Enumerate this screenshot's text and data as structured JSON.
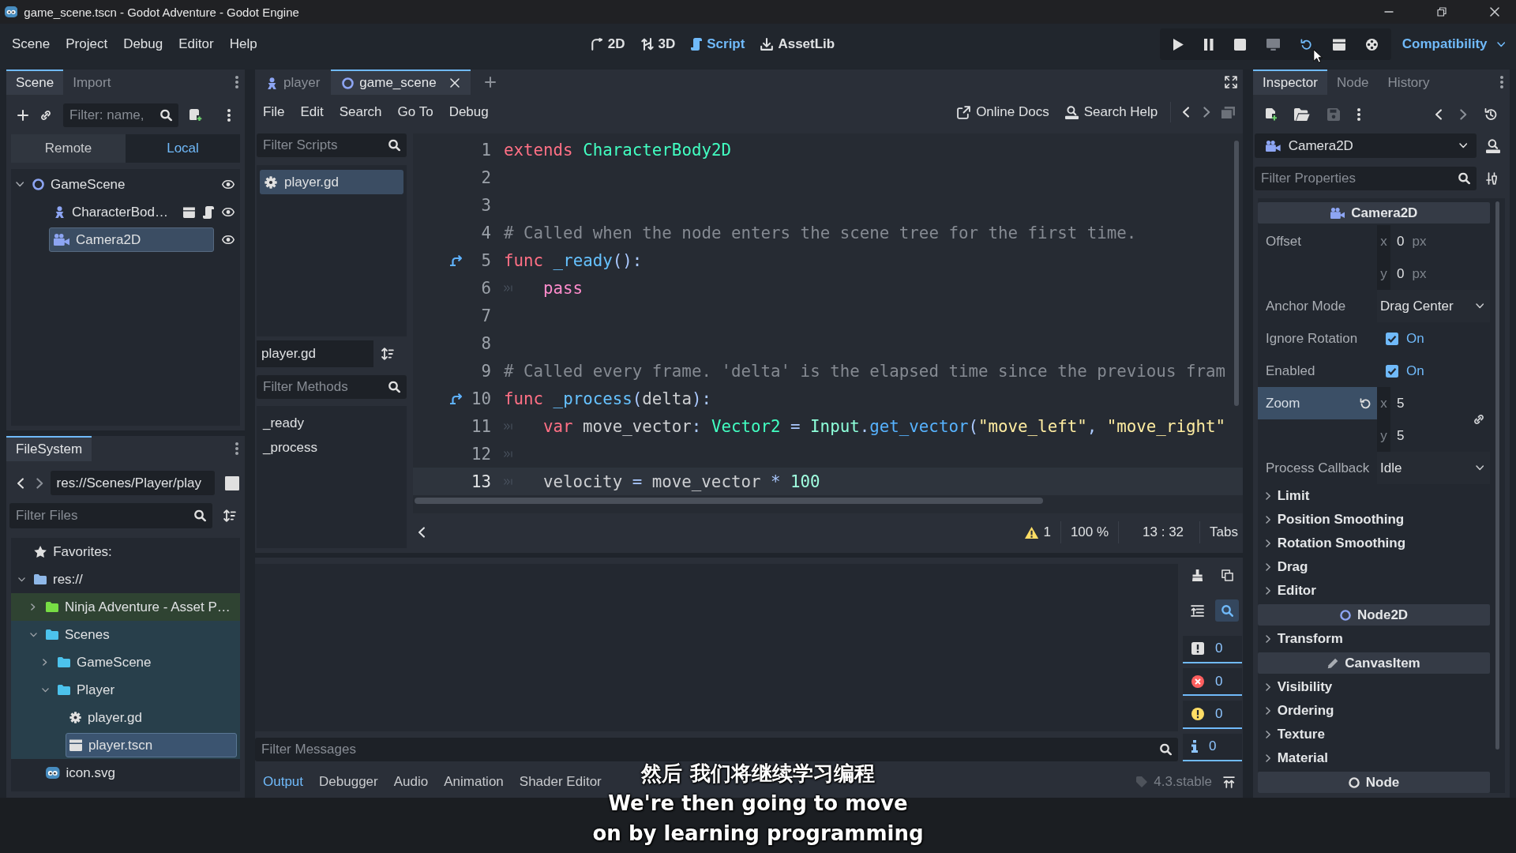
{
  "window": {
    "title": "game_scene.tscn - Godot Adventure - Godot Engine"
  },
  "menu": [
    "Scene",
    "Project",
    "Debug",
    "Editor",
    "Help"
  ],
  "workspaces": [
    {
      "label": "2D",
      "kind": "canvas",
      "selected": false
    },
    {
      "label": "3D",
      "kind": "spatial",
      "selected": false
    },
    {
      "label": "Script",
      "kind": "script",
      "selected": true
    },
    {
      "label": "AssetLib",
      "kind": "assetlib",
      "selected": false
    }
  ],
  "run_bar": {
    "buttons": [
      {
        "kind": "play",
        "hovered": false,
        "disabled": false
      },
      {
        "kind": "pause",
        "hovered": false,
        "disabled": false
      },
      {
        "kind": "stop",
        "hovered": false,
        "disabled": false
      },
      {
        "kind": "remote",
        "hovered": false,
        "disabled": true
      },
      {
        "kind": "reload",
        "hovered": true,
        "disabled": false
      },
      {
        "kind": "scene",
        "hovered": false,
        "disabled": false
      },
      {
        "kind": "movie",
        "hovered": false,
        "disabled": false
      }
    ],
    "renderer": "Compatibility"
  },
  "scene_dock": {
    "tabs": [
      {
        "label": "Scene",
        "selected": true
      },
      {
        "label": "Import",
        "selected": false
      }
    ],
    "filter": {
      "placeholder": "Filter: name,"
    },
    "modes": [
      {
        "label": "Remote",
        "selected": false
      },
      {
        "label": "Local",
        "selected": true
      }
    ],
    "tree": [
      {
        "label": "GameScene",
        "kind": "node2d",
        "expanded": true,
        "selected": false,
        "visible": true,
        "instance": false,
        "script": false,
        "children": [
          {
            "label": "CharacterBod…",
            "kind": "character",
            "selected": false,
            "visible": true,
            "instance": true,
            "script": true
          },
          {
            "label": "Camera2D",
            "kind": "camera",
            "selected": true,
            "visible": true,
            "instance": false,
            "script": false
          }
        ]
      }
    ]
  },
  "filesystem": {
    "tab": "FileSystem",
    "path": "res://Scenes/Player/play",
    "filter": {
      "placeholder": "Filter Files"
    },
    "tree": [
      {
        "label": "Favorites:",
        "kind": "favorites",
        "selected": false
      },
      {
        "label": "res://",
        "kind": "folder",
        "expanded": true,
        "selected": false,
        "children": [
          {
            "label": "Ninja Adventure - Asset P…",
            "kind": "folder",
            "expanded": false,
            "selected": false,
            "color": "#77dd44"
          },
          {
            "label": "Scenes",
            "kind": "folder",
            "expanded": true,
            "selected": false,
            "color": "#4cc2ec",
            "children": [
              {
                "label": "GameScene",
                "kind": "folder",
                "expanded": false,
                "selected": false
              },
              {
                "label": "Player",
                "kind": "folder",
                "expanded": true,
                "selected": false,
                "children": [
                  {
                    "label": "player.gd",
                    "kind": "script",
                    "selected": false
                  },
                  {
                    "label": "player.tscn",
                    "kind": "scene",
                    "selected": true
                  }
                ]
              }
            ]
          },
          {
            "label": "icon.svg",
            "kind": "image",
            "selected": false
          }
        ]
      }
    ]
  },
  "script_editor": {
    "tabs": [
      {
        "label": "player",
        "kind": "character",
        "selected": false
      },
      {
        "label": "game_scene",
        "kind": "node2d",
        "selected": true
      }
    ],
    "menu": [
      "File",
      "Edit",
      "Search",
      "Go To",
      "Debug"
    ],
    "links": [
      {
        "label": "Online Docs",
        "kind": "external"
      },
      {
        "label": "Search Help",
        "kind": "help"
      }
    ],
    "scripts_filter": {
      "placeholder": "Filter Scripts"
    },
    "scripts": [
      {
        "label": "player.gd",
        "selected": true
      }
    ],
    "current_script": "player.gd",
    "methods_filter": {
      "placeholder": "Filter Methods"
    },
    "methods": [
      {
        "label": "_ready",
        "selected": false
      },
      {
        "label": "_process",
        "selected": false
      }
    ],
    "code": [
      {
        "number": "1",
        "override": false,
        "indent": false,
        "current": false,
        "tokens": [
          {
            "kind": "keyword",
            "text": "extends "
          },
          {
            "kind": "type",
            "text": "CharacterBody2D"
          }
        ]
      },
      {
        "number": "2",
        "override": false,
        "indent": false,
        "current": false
      },
      {
        "number": "3",
        "override": false,
        "indent": false,
        "current": false
      },
      {
        "number": "4",
        "override": false,
        "indent": false,
        "current": false,
        "tokens": [
          {
            "kind": "comment",
            "text": "# Called when the node enters the scene tree for the first time."
          }
        ]
      },
      {
        "number": "5",
        "override": true,
        "indent": false,
        "current": false,
        "tokens": [
          {
            "kind": "keyword",
            "text": "func "
          },
          {
            "kind": "function",
            "text": "_ready"
          },
          {
            "kind": "symbol",
            "text": "():"
          }
        ]
      },
      {
        "number": "6",
        "override": false,
        "indent": true,
        "current": false,
        "tokens": [
          {
            "kind": "control",
            "text": "pass"
          }
        ]
      },
      {
        "number": "7",
        "override": false,
        "indent": false,
        "current": false
      },
      {
        "number": "8",
        "override": false,
        "indent": false,
        "current": false
      },
      {
        "number": "9",
        "override": false,
        "indent": false,
        "current": false,
        "tokens": [
          {
            "kind": "comment",
            "text": "# Called every frame. 'delta' is the elapsed time since the previous fram"
          }
        ]
      },
      {
        "number": "10",
        "override": true,
        "indent": false,
        "current": false,
        "tokens": [
          {
            "kind": "keyword",
            "text": "func "
          },
          {
            "kind": "function",
            "text": "_process"
          },
          {
            "kind": "symbol",
            "text": "("
          },
          {
            "kind": "plain",
            "text": "delta"
          },
          {
            "kind": "symbol",
            "text": "):"
          }
        ]
      },
      {
        "number": "11",
        "override": false,
        "indent": true,
        "current": false,
        "tokens": [
          {
            "kind": "keyword",
            "text": "var "
          },
          {
            "kind": "plain",
            "text": "move_vector"
          },
          {
            "kind": "symbol",
            "text": ": "
          },
          {
            "kind": "type",
            "text": "Vector2"
          },
          {
            "kind": "symbol",
            "text": " = "
          },
          {
            "kind": "engine",
            "text": "Input"
          },
          {
            "kind": "symbol",
            "text": "."
          },
          {
            "kind": "call",
            "text": "get_vector"
          },
          {
            "kind": "symbol",
            "text": "("
          },
          {
            "kind": "string",
            "text": "\"move_left\""
          },
          {
            "kind": "symbol",
            "text": ", "
          },
          {
            "kind": "string",
            "text": "\"move_right\""
          }
        ]
      },
      {
        "number": "12",
        "override": false,
        "indent": true,
        "current": false
      },
      {
        "number": "13",
        "override": false,
        "indent": true,
        "current": true,
        "tokens": [
          {
            "kind": "plain",
            "text": "velocity"
          },
          {
            "kind": "symbol",
            "text": " = "
          },
          {
            "kind": "plain",
            "text": "move_vector"
          },
          {
            "kind": "symbol",
            "text": " * "
          },
          {
            "kind": "number",
            "text": "100"
          }
        ]
      }
    ],
    "status": {
      "warnings": "1",
      "zoom": "100 %",
      "position": "13 : 32",
      "indent": "Tabs"
    }
  },
  "output": {
    "tools": [
      {
        "kind": "clear",
        "on": false
      },
      {
        "kind": "copy",
        "on": false
      },
      {
        "kind": "collapse",
        "on": false
      },
      {
        "kind": "search",
        "on": true
      }
    ],
    "counters": [
      {
        "kind": "message",
        "count": "0",
        "on": true
      },
      {
        "kind": "error",
        "count": "0",
        "on": true
      },
      {
        "kind": "warning",
        "count": "0",
        "on": true
      },
      {
        "kind": "info",
        "count": "0",
        "on": true
      }
    ],
    "filter": {
      "placeholder": "Filter Messages"
    }
  },
  "bottom_tabs": [
    {
      "label": "Output",
      "selected": true
    },
    {
      "label": "Debugger",
      "selected": false
    },
    {
      "label": "Audio",
      "selected": false
    },
    {
      "label": "Animation",
      "selected": false
    },
    {
      "label": "Shader Editor",
      "selected": false
    }
  ],
  "version": "4.3.stable",
  "inspector": {
    "tabs": [
      {
        "label": "Inspector",
        "selected": true
      },
      {
        "label": "Node",
        "selected": false
      },
      {
        "label": "History",
        "selected": false
      }
    ],
    "tools": [
      {
        "kind": "new",
        "disabled": false
      },
      {
        "kind": "open",
        "disabled": false
      },
      {
        "kind": "save",
        "disabled": true
      }
    ],
    "object": {
      "label": "Camera2D",
      "kind": "camera"
    },
    "filter": {
      "placeholder": "Filter Properties"
    },
    "sections": [
      {
        "title": "Camera2D",
        "kind": "camera",
        "rows": [
          {
            "kind": "vector",
            "label": "Offset",
            "selected": false,
            "revertable": false,
            "linked": false,
            "components": [
              {
                "axis": "x",
                "value": "0",
                "unit": "px"
              },
              {
                "axis": "y",
                "value": "0",
                "unit": "px"
              }
            ]
          },
          {
            "kind": "enum",
            "label": "Anchor Mode",
            "selected": false,
            "revertable": false,
            "value": "Drag Center"
          },
          {
            "kind": "check",
            "label": "Ignore Rotation",
            "selected": false,
            "revertable": false,
            "checked": true,
            "value": "On"
          },
          {
            "kind": "check",
            "label": "Enabled",
            "selected": false,
            "revertable": false,
            "checked": true,
            "value": "On"
          },
          {
            "kind": "vector",
            "label": "Zoom",
            "selected": true,
            "revertable": true,
            "linked": true,
            "components": [
              {
                "axis": "x",
                "value": "5"
              },
              {
                "axis": "y",
                "value": "5"
              }
            ]
          },
          {
            "kind": "enum",
            "label": "Process Callback",
            "selected": false,
            "revertable": false,
            "value": "Idle"
          },
          {
            "kind": "group",
            "label": "Limit",
            "expanded": false
          },
          {
            "kind": "group",
            "label": "Position Smoothing",
            "expanded": false
          },
          {
            "kind": "group",
            "label": "Rotation Smoothing",
            "expanded": false
          },
          {
            "kind": "group",
            "label": "Drag",
            "expanded": false
          },
          {
            "kind": "group",
            "label": "Editor",
            "expanded": false
          }
        ]
      },
      {
        "title": "Node2D",
        "kind": "node2d",
        "rows": [
          {
            "kind": "group",
            "label": "Transform",
            "expanded": false
          }
        ]
      },
      {
        "title": "CanvasItem",
        "kind": "canvasitem",
        "rows": [
          {
            "kind": "group",
            "label": "Visibility",
            "expanded": false
          },
          {
            "kind": "group",
            "label": "Ordering",
            "expanded": false
          },
          {
            "kind": "group",
            "label": "Texture",
            "expanded": false
          },
          {
            "kind": "group",
            "label": "Material",
            "expanded": false
          }
        ]
      },
      {
        "title": "Node",
        "kind": "node"
      }
    ]
  },
  "subtitles": [
    "然后 我们将继续学习编程",
    "We're then going to move",
    "on by learning programming"
  ]
}
